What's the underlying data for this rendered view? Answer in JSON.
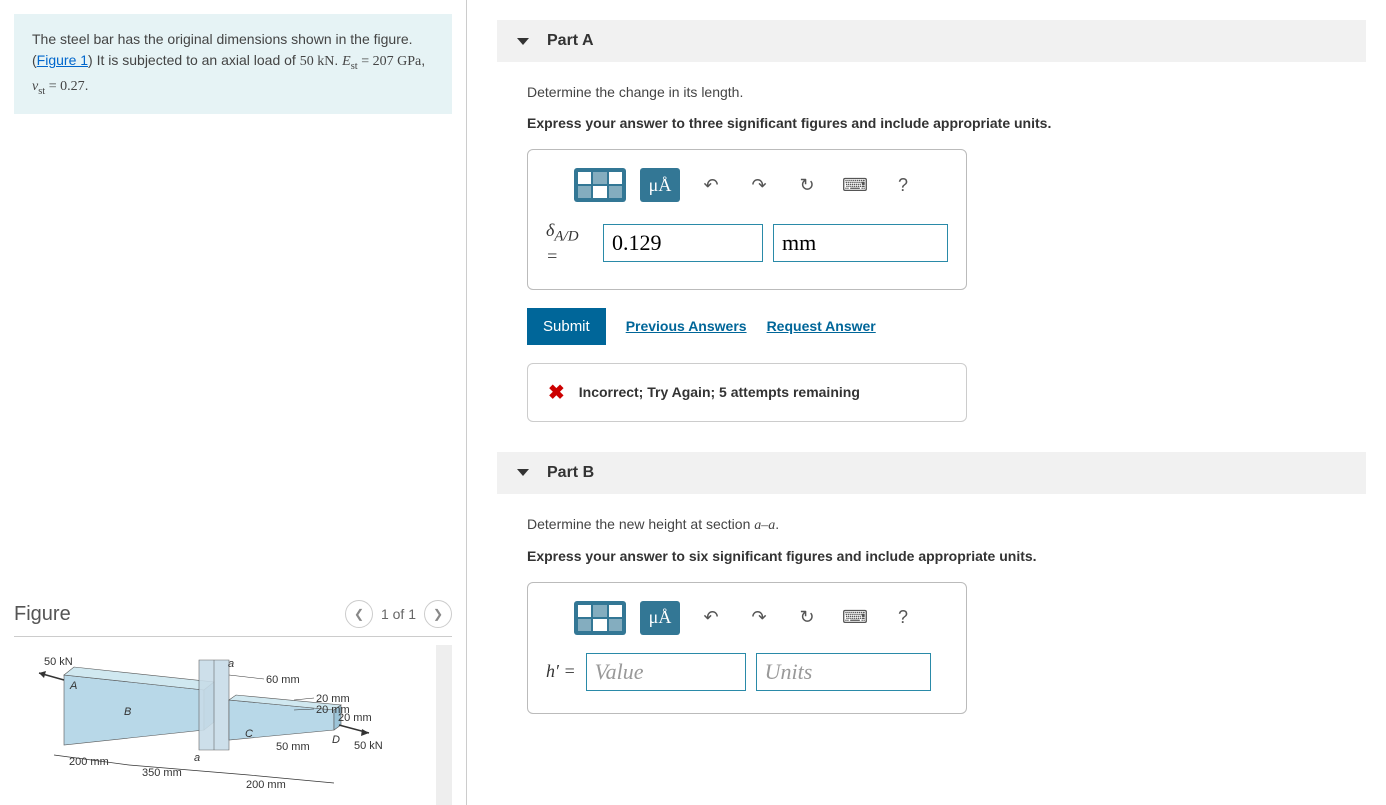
{
  "problem": {
    "text_before_link": "The steel bar has the original dimensions shown in the figure. (",
    "figure_link": "Figure 1",
    "text_after_link": ") It is subjected to an axial load of ",
    "load": "50 kN",
    "period1": ". ",
    "E_var": "E",
    "E_sub": "st",
    "eq": " = ",
    "E_val": "207 GPa",
    "comma": ", ",
    "nu_var": "ν",
    "nu_sub": "st",
    "nu_val": "0.27",
    "period2": "."
  },
  "figure": {
    "heading": "Figure",
    "nav_label": "1 of 1",
    "labels": {
      "force_left": "50 kN",
      "force_right": "50 kN",
      "h60": "60 mm",
      "h20a": "20 mm",
      "h20b": "20 mm",
      "h20c": "20 mm",
      "w50": "50 mm",
      "L200a": "200 mm",
      "L350": "350 mm",
      "L200b": "200 mm",
      "ptA": "A",
      "ptB": "B",
      "ptC": "C",
      "ptD": "D",
      "sec_a1": "a",
      "sec_a2": "a"
    }
  },
  "partA": {
    "title": "Part A",
    "prompt": "Determine the change in its length.",
    "instruction": "Express your answer to three significant figures and include appropriate units.",
    "toolbar": {
      "mua": "μÅ",
      "help": "?"
    },
    "var_label_html": "δ<sub>A/D</sub> = ",
    "value_input": "0.129",
    "units_input": "mm",
    "submit": "Submit",
    "prev_answers": "Previous Answers",
    "request_answer": "Request Answer",
    "feedback": "Incorrect; Try Again; 5 attempts remaining"
  },
  "partB": {
    "title": "Part B",
    "prompt_before": "Determine the new height at section ",
    "prompt_var": "a–a",
    "prompt_after": ".",
    "instruction": "Express your answer to six significant figures and include appropriate units.",
    "toolbar": {
      "mua": "μÅ",
      "help": "?"
    },
    "var_label": "h′ = ",
    "value_placeholder": "Value",
    "units_placeholder": "Units"
  }
}
